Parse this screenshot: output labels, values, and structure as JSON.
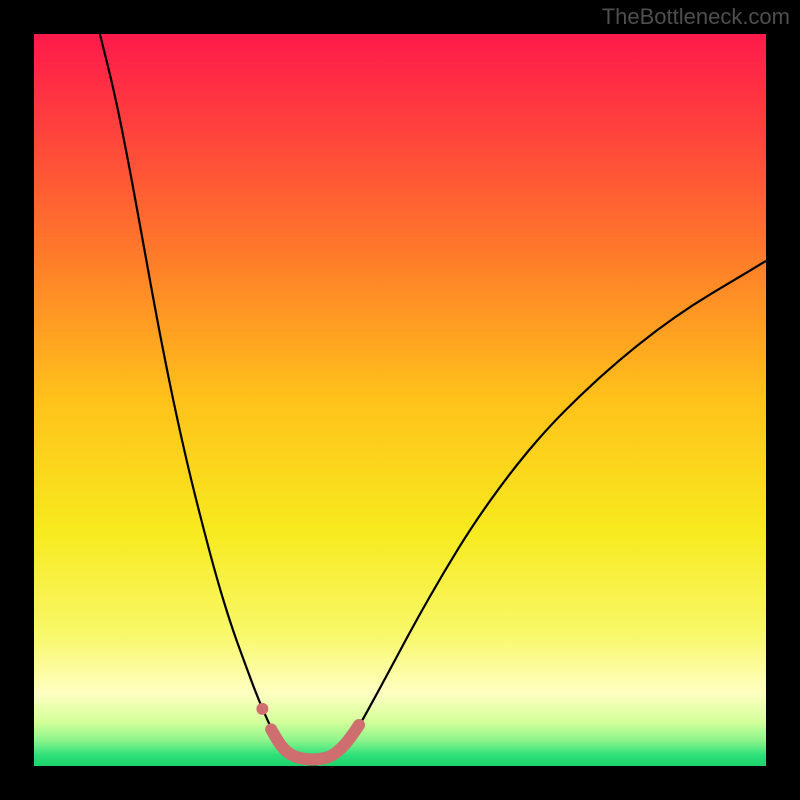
{
  "watermark": "TheBottleneck.com",
  "chart_data": {
    "type": "line",
    "title": "",
    "xlabel": "",
    "ylabel": "",
    "xlim": [
      0,
      100
    ],
    "ylim": [
      0,
      100
    ],
    "background_gradient": {
      "stops": [
        {
          "offset": 0.0,
          "color": "#ff1a4b"
        },
        {
          "offset": 0.12,
          "color": "#ff3e3e"
        },
        {
          "offset": 0.3,
          "color": "#ff7a2a"
        },
        {
          "offset": 0.5,
          "color": "#ffc21a"
        },
        {
          "offset": 0.68,
          "color": "#f7ea1e"
        },
        {
          "offset": 0.82,
          "color": "#f8f86a"
        },
        {
          "offset": 0.9,
          "color": "#ffffc2"
        },
        {
          "offset": 0.94,
          "color": "#d4ff9a"
        },
        {
          "offset": 0.965,
          "color": "#8cf58c"
        },
        {
          "offset": 0.985,
          "color": "#2ee07a"
        },
        {
          "offset": 1.0,
          "color": "#1bd46a"
        }
      ]
    },
    "series": [
      {
        "name": "bottleneck-curve",
        "stroke": "#000000",
        "stroke_width": 2.2,
        "points": [
          {
            "x": 9.0,
            "y": 100.0
          },
          {
            "x": 11.0,
            "y": 92.0
          },
          {
            "x": 13.0,
            "y": 82.0
          },
          {
            "x": 15.0,
            "y": 71.0
          },
          {
            "x": 17.0,
            "y": 60.0
          },
          {
            "x": 19.0,
            "y": 50.0
          },
          {
            "x": 21.0,
            "y": 41.0
          },
          {
            "x": 23.0,
            "y": 33.0
          },
          {
            "x": 25.0,
            "y": 25.5
          },
          {
            "x": 27.0,
            "y": 19.0
          },
          {
            "x": 29.0,
            "y": 13.5
          },
          {
            "x": 30.5,
            "y": 9.5
          },
          {
            "x": 32.0,
            "y": 6.0
          },
          {
            "x": 33.5,
            "y": 3.0
          },
          {
            "x": 35.0,
            "y": 1.2
          },
          {
            "x": 37.0,
            "y": 0.2
          },
          {
            "x": 39.0,
            "y": 0.2
          },
          {
            "x": 41.0,
            "y": 1.0
          },
          {
            "x": 43.0,
            "y": 3.0
          },
          {
            "x": 45.0,
            "y": 6.5
          },
          {
            "x": 48.0,
            "y": 12.0
          },
          {
            "x": 52.0,
            "y": 19.5
          },
          {
            "x": 56.0,
            "y": 26.5
          },
          {
            "x": 60.0,
            "y": 33.0
          },
          {
            "x": 65.0,
            "y": 40.0
          },
          {
            "x": 70.0,
            "y": 46.0
          },
          {
            "x": 75.0,
            "y": 51.0
          },
          {
            "x": 80.0,
            "y": 55.5
          },
          {
            "x": 85.0,
            "y": 59.5
          },
          {
            "x": 90.0,
            "y": 63.0
          },
          {
            "x": 95.0,
            "y": 66.0
          },
          {
            "x": 100.0,
            "y": 69.0
          }
        ]
      },
      {
        "name": "highlight-band",
        "stroke": "#cf6e6e",
        "stroke_width": 12,
        "linecap": "round",
        "points": [
          {
            "x": 32.4,
            "y": 5.0
          },
          {
            "x": 33.8,
            "y": 2.6
          },
          {
            "x": 35.2,
            "y": 1.4
          },
          {
            "x": 37.0,
            "y": 0.9
          },
          {
            "x": 39.0,
            "y": 0.9
          },
          {
            "x": 40.6,
            "y": 1.3
          },
          {
            "x": 42.0,
            "y": 2.4
          },
          {
            "x": 43.2,
            "y": 3.8
          },
          {
            "x": 44.4,
            "y": 5.6
          }
        ]
      }
    ],
    "markers": [
      {
        "name": "highlight-dot",
        "x": 31.2,
        "y": 7.8,
        "r": 6,
        "fill": "#cf6e6e"
      }
    ]
  }
}
